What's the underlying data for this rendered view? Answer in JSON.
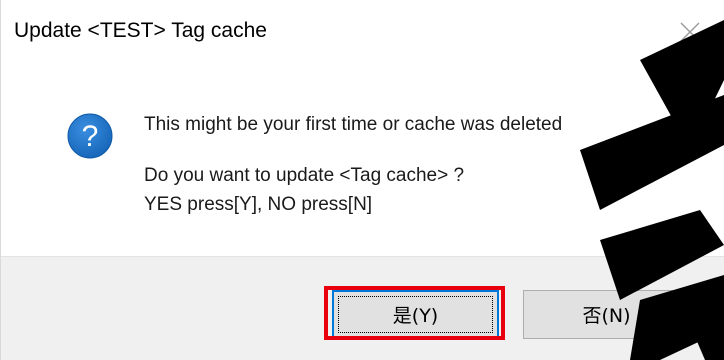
{
  "window": {
    "title": "Update <TEST> Tag cache",
    "close_symbol": "✕"
  },
  "icon": {
    "name": "question-icon",
    "glyph": "?",
    "color": "#1a6ec1"
  },
  "message": {
    "line1": "This might be your first time or cache was deleted",
    "line2": "Do you want to update <Tag cache> ?",
    "line3": "YES press[Y],  NO press[N]"
  },
  "buttons": {
    "yes_label": "是(Y)",
    "no_label": "否(N)"
  },
  "colors": {
    "highlight": "#e8000e",
    "footer": "#f0f0f0",
    "button_focus": "#0078d7",
    "watermark": "#000000"
  }
}
